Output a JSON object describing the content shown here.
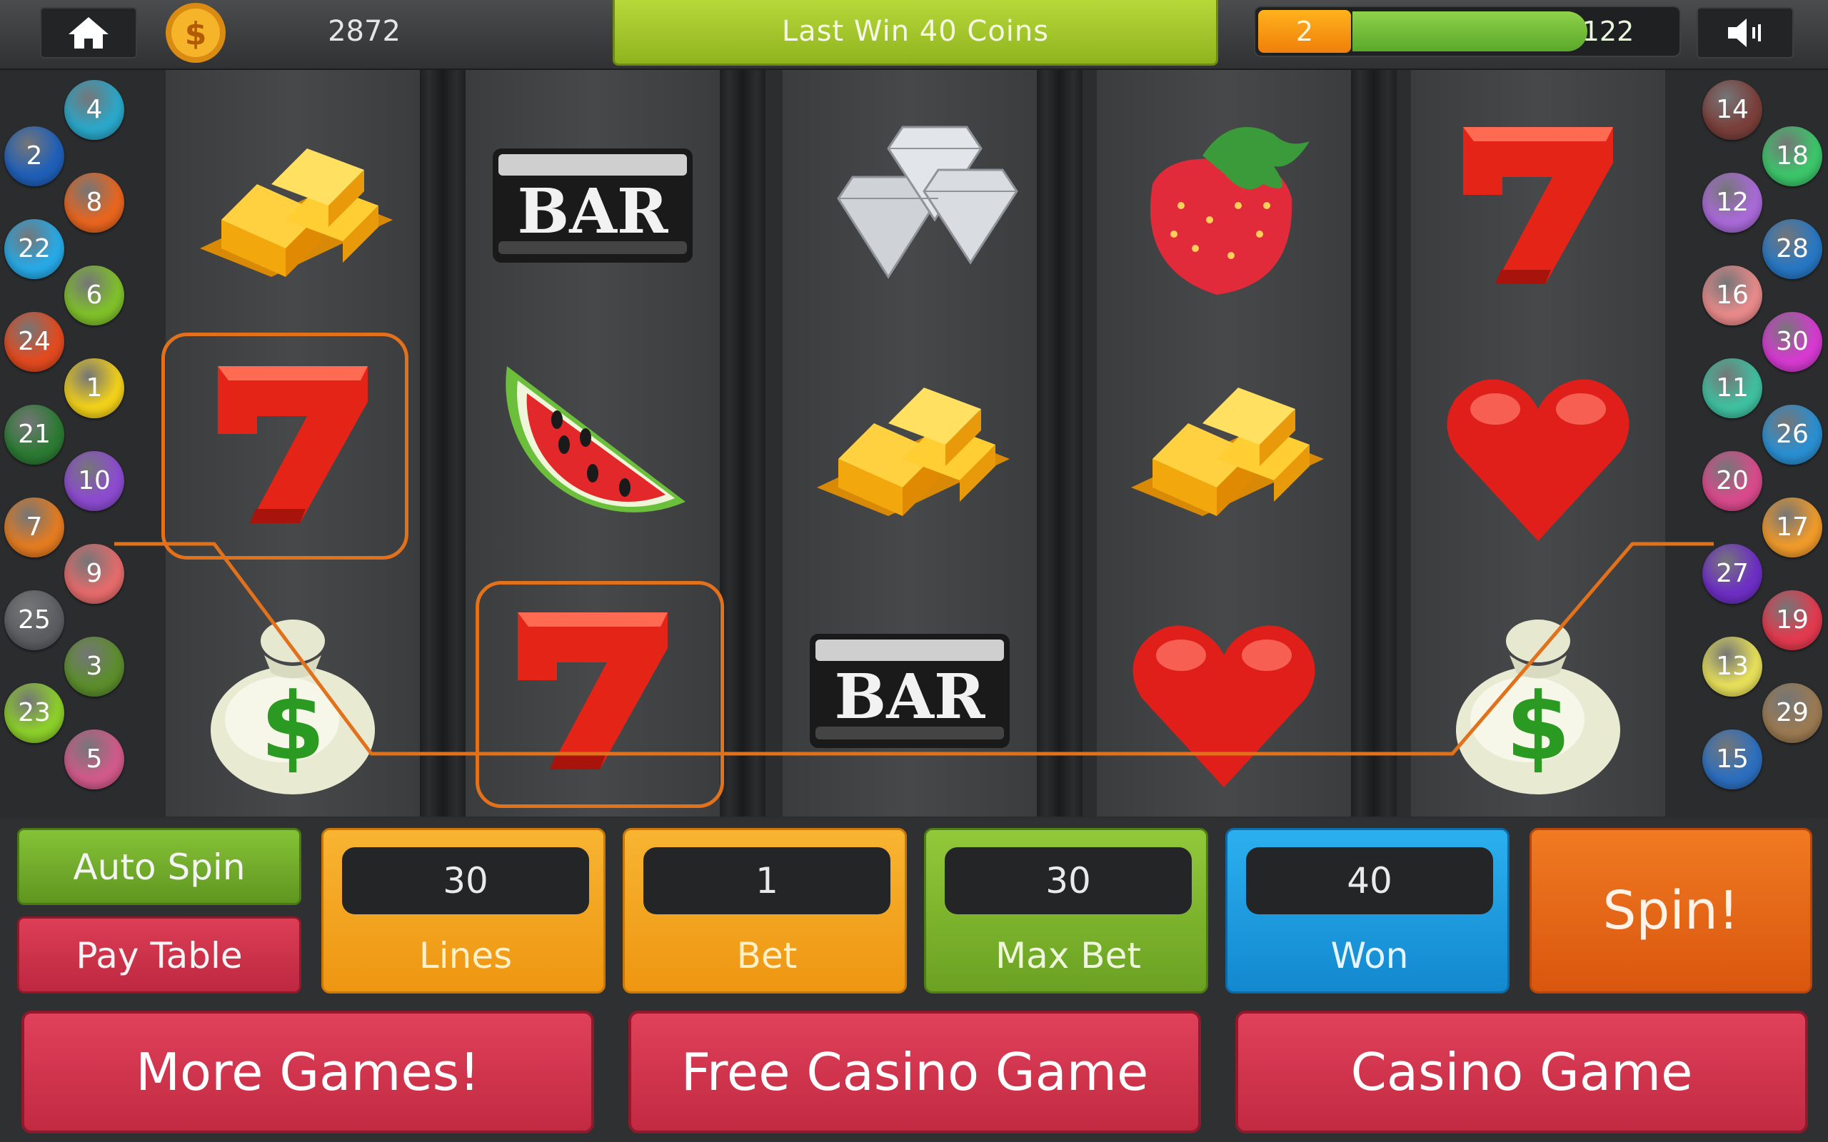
{
  "topbar": {
    "coins": "2872",
    "last_win": "Last Win 40 Coins",
    "level": "2",
    "xp": "122",
    "xp_progress": 0.73
  },
  "reels": [
    [
      "gold-bars",
      "seven",
      "money-bag"
    ],
    [
      "bar",
      "watermelon",
      "seven"
    ],
    [
      "diamonds",
      "gold-bars",
      "bar"
    ],
    [
      "strawberry",
      "gold-bars",
      "heart"
    ],
    [
      "seven",
      "heart",
      "money-bag"
    ]
  ],
  "symbol_labels": {
    "bar": "BAR",
    "money_sign": "$"
  },
  "line_badges_left": [
    {
      "n": "4",
      "color": "#2aa7c9"
    },
    {
      "n": "2",
      "color": "#1f5fb8"
    },
    {
      "n": "8",
      "color": "#e8651e"
    },
    {
      "n": "22",
      "color": "#27a9e6"
    },
    {
      "n": "6",
      "color": "#7fc02a"
    },
    {
      "n": "24",
      "color": "#e24a1f"
    },
    {
      "n": "1",
      "color": "#f1d01a"
    },
    {
      "n": "21",
      "color": "#2c7a33"
    },
    {
      "n": "10",
      "color": "#8c4bd0"
    },
    {
      "n": "7",
      "color": "#e37b21"
    },
    {
      "n": "9",
      "color": "#e46b6b"
    },
    {
      "n": "25",
      "color": "#5b5d60"
    },
    {
      "n": "3",
      "color": "#5c8d2c"
    },
    {
      "n": "23",
      "color": "#8ccf2a"
    },
    {
      "n": "5",
      "color": "#d15a8a"
    }
  ],
  "line_badges_right": [
    {
      "n": "14",
      "color": "#7a3f3a"
    },
    {
      "n": "18",
      "color": "#3cc66a"
    },
    {
      "n": "12",
      "color": "#a96ad8"
    },
    {
      "n": "28",
      "color": "#2777c3"
    },
    {
      "n": "16",
      "color": "#e88a8a"
    },
    {
      "n": "30",
      "color": "#d63ad1"
    },
    {
      "n": "11",
      "color": "#3fc0a0"
    },
    {
      "n": "26",
      "color": "#2a8fd1"
    },
    {
      "n": "20",
      "color": "#d94a8c"
    },
    {
      "n": "17",
      "color": "#f09a2a"
    },
    {
      "n": "27",
      "color": "#6d2fc4"
    },
    {
      "n": "19",
      "color": "#e23a4e"
    },
    {
      "n": "13",
      "color": "#e6df5a"
    },
    {
      "n": "29",
      "color": "#9a7a52"
    },
    {
      "n": "15",
      "color": "#2c6fbf"
    }
  ],
  "controls": {
    "auto_spin": "Auto Spin",
    "pay_table": "Pay Table",
    "lines_value": "30",
    "lines_label": "Lines",
    "bet_value": "1",
    "bet_label": "Bet",
    "max_bet_value": "30",
    "max_bet_label": "Max Bet",
    "won_value": "40",
    "won_label": "Won",
    "spin": "Spin!",
    "more_games": "More Games!",
    "free_casino": "Free Casino Game",
    "casino_game": "Casino Game"
  },
  "colors": {
    "accent_orange": "#e2711c",
    "lines_box": "#f4a51e",
    "bet_box": "#f29f1a",
    "max_bet_box": "#7bb428",
    "won_box": "#1f9ee0",
    "spin": "#e86a16",
    "red_buttons": "#d23650"
  }
}
